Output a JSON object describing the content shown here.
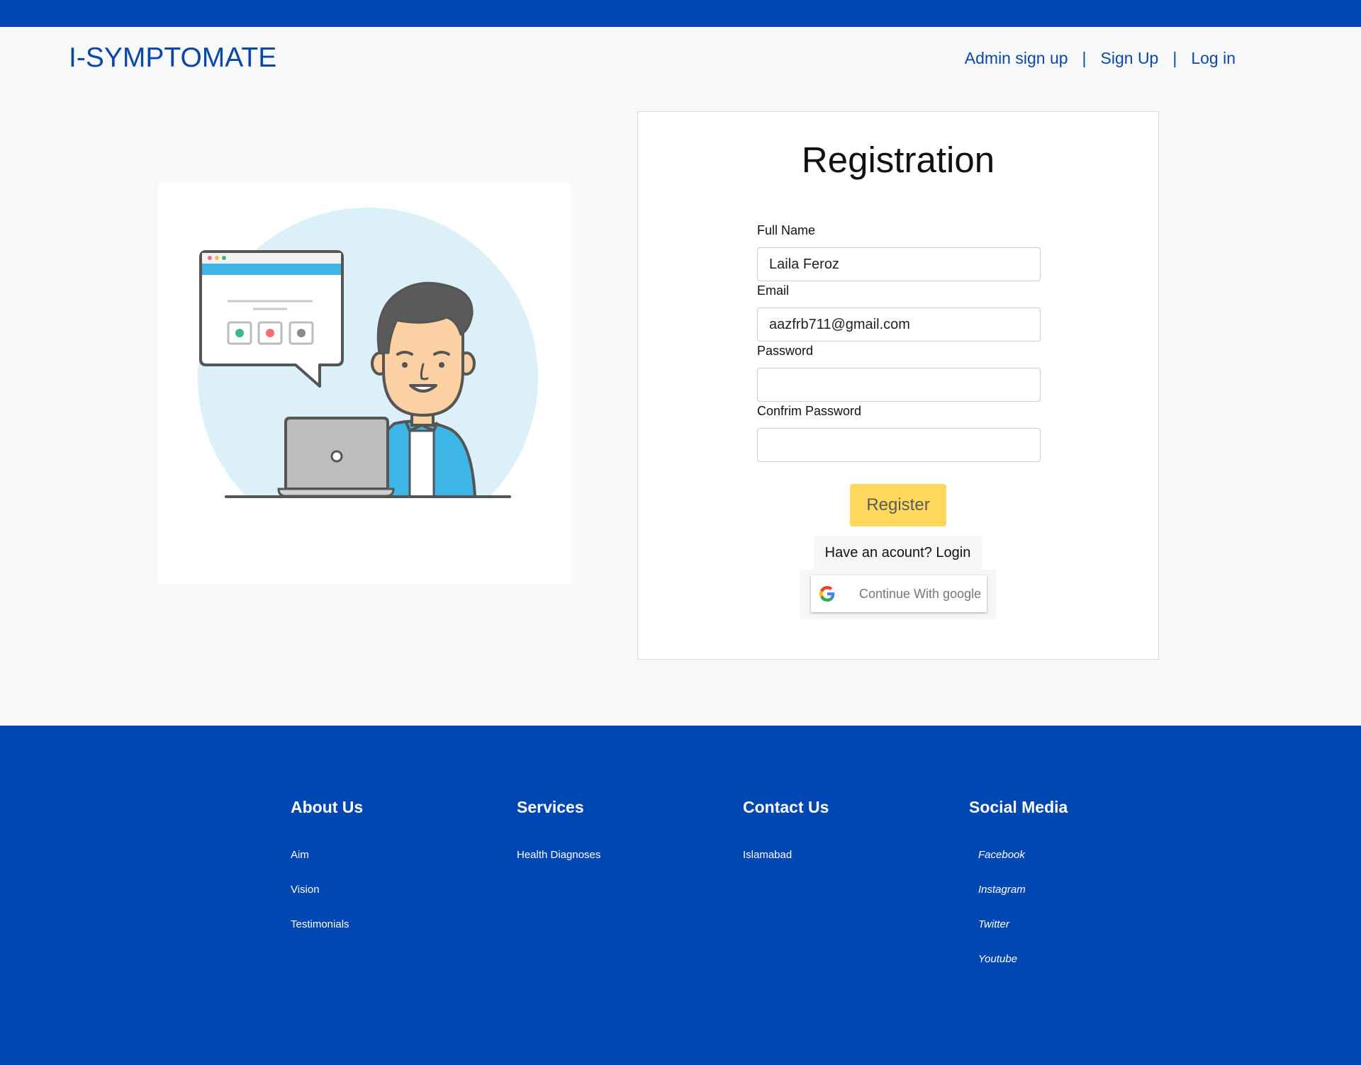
{
  "header": {
    "brand": "I-SYMPTOMATE",
    "nav": {
      "admin_signup": "Admin sign up",
      "signup": "Sign Up",
      "login": "Log in",
      "separator": "|"
    }
  },
  "registration": {
    "title": "Registration",
    "fields": {
      "full_name": {
        "label": "Full Name",
        "value": "Laila Feroz"
      },
      "email": {
        "label": "Email",
        "value": "aazfrb711@gmail.com"
      },
      "password": {
        "label": "Password",
        "value": ""
      },
      "confirm_password": {
        "label": "Confrim Password",
        "value": ""
      }
    },
    "register_label": "Register",
    "have_account": "Have an acount? Login",
    "google_label": "Continue With google"
  },
  "footer": {
    "about": {
      "title": "About Us",
      "items": [
        "Aim",
        "Vision",
        "Testimonials"
      ]
    },
    "services": {
      "title": "Services",
      "items": [
        "Health Diagnoses"
      ]
    },
    "contact": {
      "title": "Contact Us",
      "items": [
        "Islamabad"
      ]
    },
    "social": {
      "title": "Social Media",
      "items": [
        "Facebook",
        "Instagram",
        "Twitter",
        "Youtube"
      ]
    }
  },
  "colors": {
    "brand_blue": "#0047b3",
    "register_yellow": "#fed85d"
  }
}
